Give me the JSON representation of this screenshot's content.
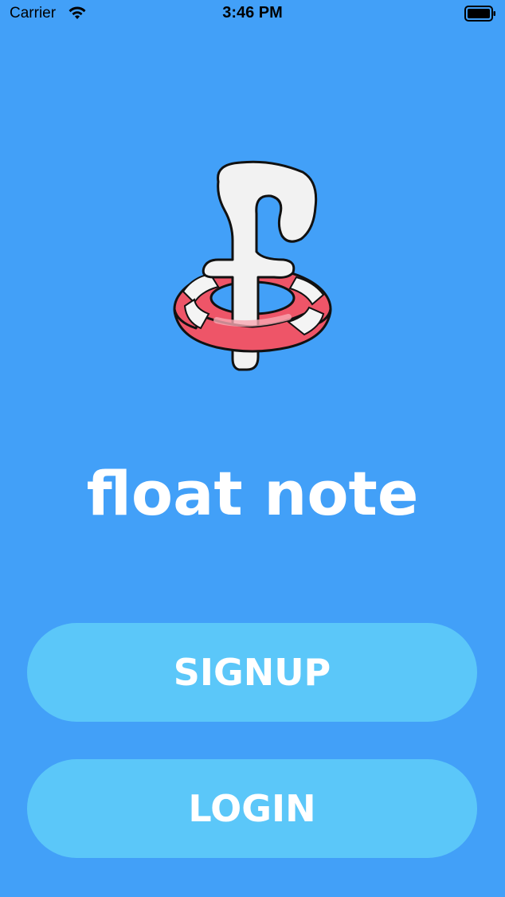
{
  "status_bar": {
    "carrier": "Carrier",
    "time": "3:46 PM",
    "icons": [
      "wifi-icon",
      "battery-icon"
    ]
  },
  "logo": {
    "icon": "float-note-logo-icon",
    "description_colors": {
      "ring_red": "#ee5568",
      "ring_white": "#f4f4f4",
      "letter_fill": "#f2f2f2",
      "outline": "#111111"
    }
  },
  "app": {
    "title": "float note"
  },
  "buttons": {
    "signup_label": "SIGNUP",
    "login_label": "LOGIN"
  },
  "colors": {
    "background": "#42a0f8",
    "button": "#5bc7f9",
    "text": "#ffffff"
  }
}
